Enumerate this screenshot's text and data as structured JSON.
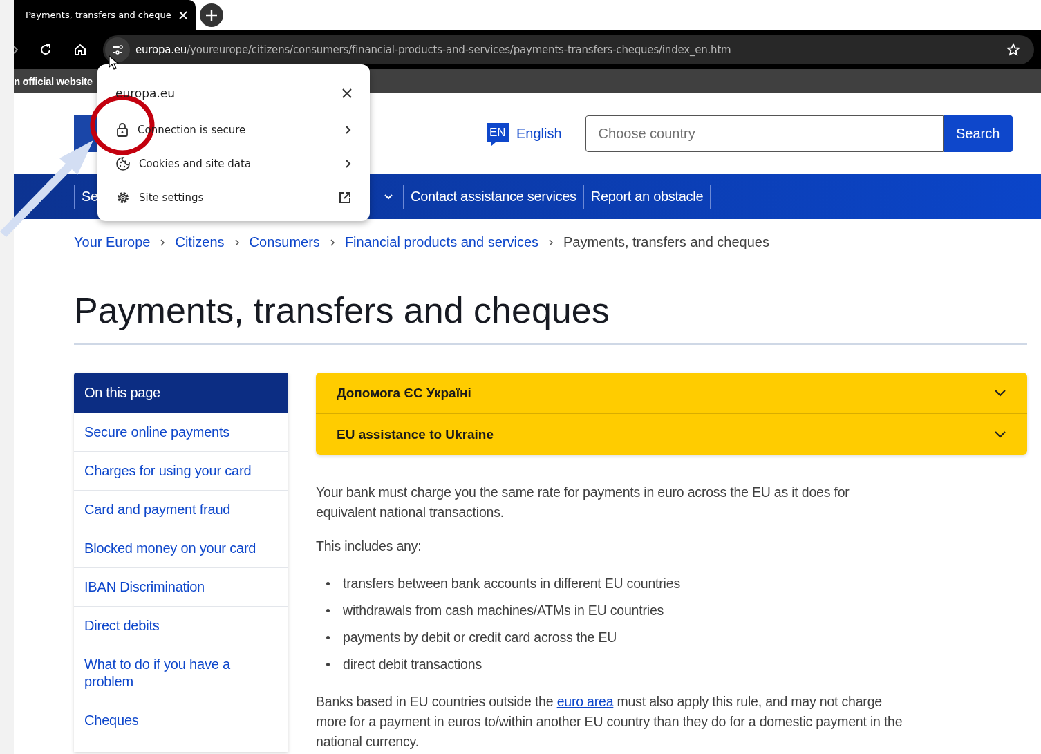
{
  "browser": {
    "tab": {
      "title": "Payments, transfers and cheque"
    },
    "address": {
      "domain": "europa.eu",
      "path": "/youreurope/citizens/consumers/financial-products-and-services/payments-transfers-cheques/index_en.htm"
    }
  },
  "site_info_popup": {
    "title": "europa.eu",
    "items": [
      {
        "label": "Connection is secure",
        "kind": "submenu"
      },
      {
        "label": "Cookies and site data",
        "kind": "submenu"
      },
      {
        "label": "Site settings",
        "kind": "external"
      }
    ]
  },
  "official_banner": {
    "text": "n official website"
  },
  "header": {
    "language": {
      "code": "EN",
      "label": "English"
    },
    "search": {
      "placeholder": "Choose country",
      "button": "Search"
    }
  },
  "nav": {
    "items": [
      {
        "label": "Se",
        "dropdown": true
      },
      {
        "label": "Contact assistance services",
        "dropdown": false
      },
      {
        "label": "Report an obstacle",
        "dropdown": false
      }
    ]
  },
  "breadcrumbs": {
    "links": [
      "Your Europe",
      "Citizens",
      "Consumers",
      "Financial products and services"
    ],
    "current": "Payments, transfers and cheques"
  },
  "title": "Payments, transfers and cheques",
  "toc": {
    "heading": "On this page",
    "items": [
      "Secure online payments",
      "Charges for using your card",
      "Card and payment fraud",
      "Blocked money on your card",
      "IBAN Discrimination",
      "Direct debits",
      "What to do if you have a problem",
      "Cheques"
    ]
  },
  "accordions": [
    {
      "label": "Допомога ЄС Україні",
      "expanded": false
    },
    {
      "label": "EU assistance to Ukraine",
      "expanded": false
    }
  ],
  "body": {
    "intro": "Your bank must charge you the same rate for payments in euro across the EU as it does for equivalent national transactions.",
    "lead": "This includes any:",
    "bullets": [
      "transfers between bank accounts in different EU countries",
      "withdrawals from cash machines/ATMs in EU countries",
      "payments by debit or credit card across the EU",
      "direct debit transactions"
    ],
    "closing": {
      "before": "Banks based in EU countries outside the",
      "link": "euro area",
      "after": "must also apply this rule, and may not charge more for a payment in euros to/within another EU country than they do for a domestic payment in the national currency."
    }
  }
}
